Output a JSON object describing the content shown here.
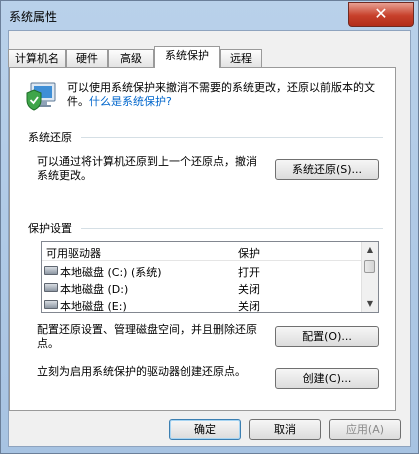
{
  "window": {
    "title": "系统属性",
    "close_glyph": "✕"
  },
  "tabs": [
    {
      "label": "计算机名"
    },
    {
      "label": "硬件"
    },
    {
      "label": "高级"
    },
    {
      "label": "系统保护",
      "active": true
    },
    {
      "label": "远程"
    }
  ],
  "intro": {
    "text": "可以使用系统保护来撤消不需要的系统更改，还原以前版本的文件。",
    "link": "什么是系统保护?"
  },
  "restore": {
    "section_label": "系统还原",
    "description": "可以通过将计算机还原到上一个还原点，撤消系统更改。",
    "button": "系统还原(S)..."
  },
  "protection": {
    "section_label": "保护设置",
    "columns": {
      "drive": "可用驱动器",
      "protection": "保护"
    },
    "rows": [
      {
        "drive": "本地磁盘 (C:) (系统)",
        "protection": "打开"
      },
      {
        "drive": "本地磁盘 (D:)",
        "protection": "关闭"
      },
      {
        "drive": "本地磁盘 (E:)",
        "protection": "关闭"
      }
    ]
  },
  "configure": {
    "description": "配置还原设置、管理磁盘空间，并且删除还原点。",
    "button": "配置(O)..."
  },
  "create": {
    "description": "立刻为启用系统保护的驱动器创建还原点。",
    "button": "创建(C)..."
  },
  "footer": {
    "ok": "确定",
    "cancel": "取消",
    "apply": "应用(A)"
  },
  "icons": {
    "shield": "system-protection-icon",
    "drive": "hard-drive-icon"
  }
}
